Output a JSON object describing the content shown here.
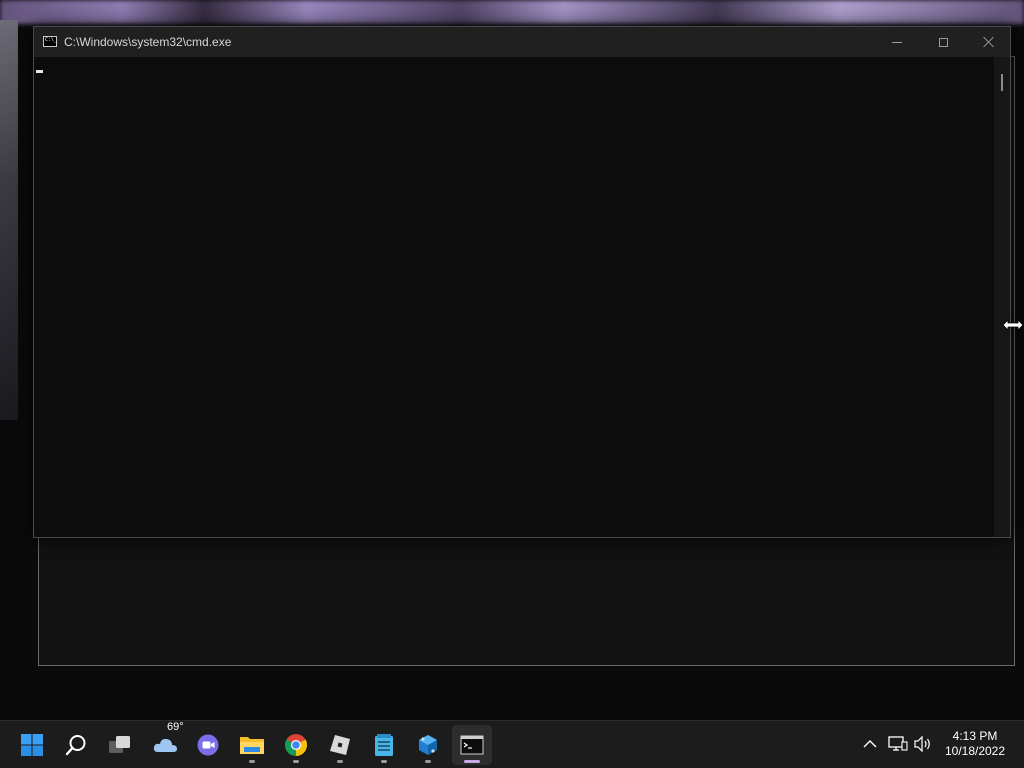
{
  "window": {
    "title": "C:\\Windows\\system32\\cmd.exe",
    "minimize_icon": "minimize-icon",
    "maximize_icon": "maximize-icon",
    "close_icon": "close-icon"
  },
  "taskbar": {
    "items": [
      {
        "name": "start-button",
        "icon": "windows-logo-icon"
      },
      {
        "name": "search-button",
        "icon": "search-icon"
      },
      {
        "name": "task-view-button",
        "icon": "task-view-icon"
      },
      {
        "name": "weather-widget",
        "icon": "cloud-icon",
        "label": "69°"
      },
      {
        "name": "teams-chat-button",
        "icon": "video-chat-icon"
      },
      {
        "name": "file-explorer-button",
        "icon": "folder-icon"
      },
      {
        "name": "chrome-button",
        "icon": "chrome-icon"
      },
      {
        "name": "roblox-button",
        "icon": "roblox-icon"
      },
      {
        "name": "notepad-button",
        "icon": "notepad-icon"
      },
      {
        "name": "app-button",
        "icon": "cube-app-icon"
      },
      {
        "name": "cmd-button",
        "icon": "command-prompt-icon"
      }
    ],
    "weather_temp": "69°"
  },
  "tray": {
    "icons": [
      "chevron-up-icon",
      "network-icon",
      "volume-icon"
    ],
    "time": "4:13 PM",
    "date": "10/18/2022"
  },
  "colors": {
    "console_bg": "#0c0c0c",
    "titlebar_bg": "#202020",
    "taskbar_bg": "#1c1c1c",
    "active_indicator": "#c9a6e6"
  }
}
